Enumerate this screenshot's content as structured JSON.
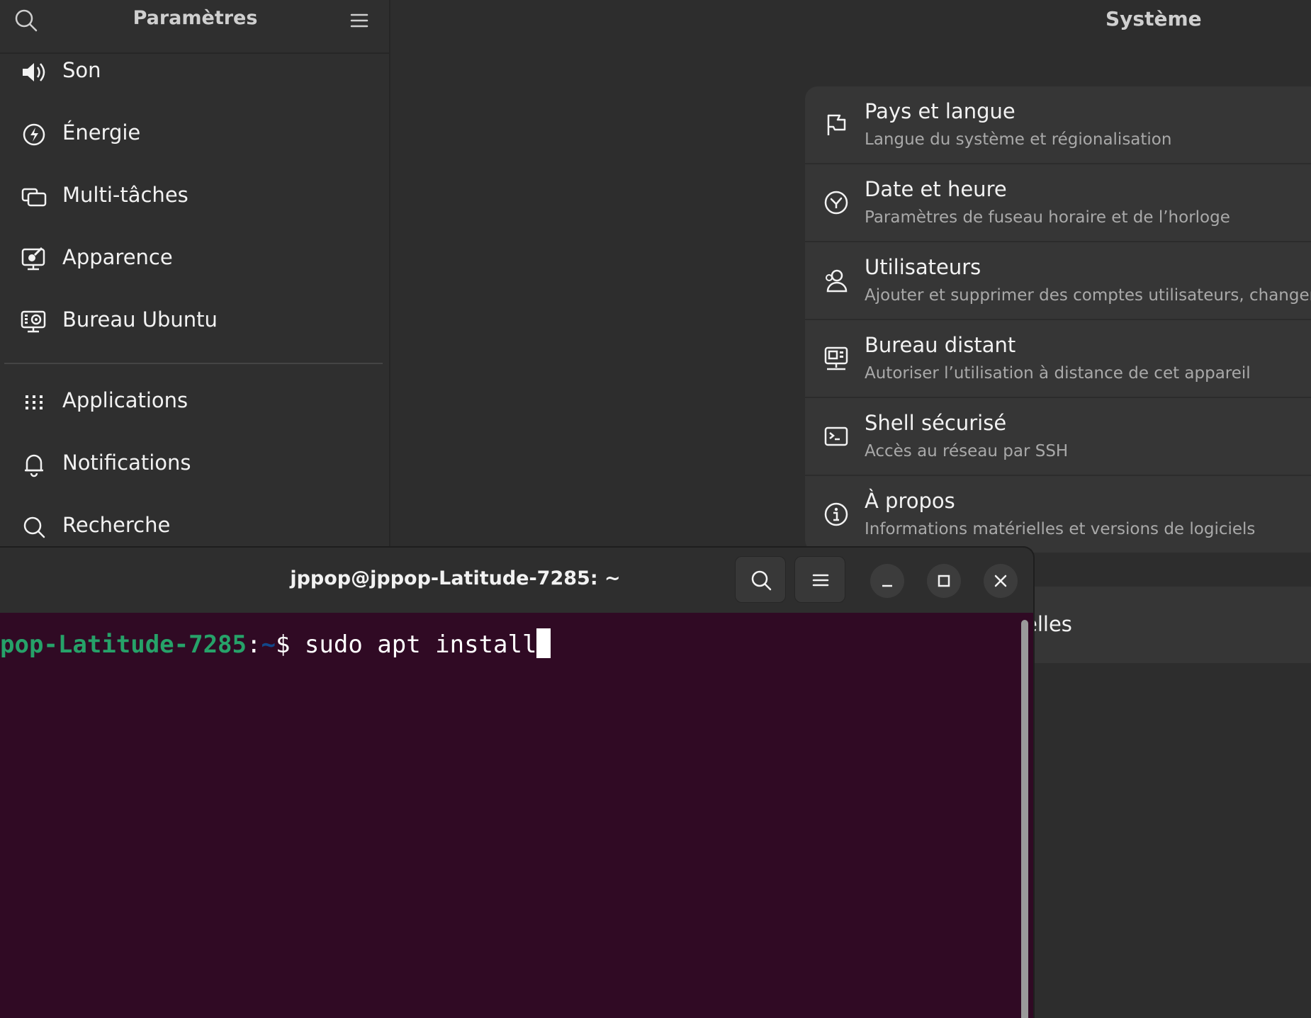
{
  "sidebar": {
    "title": "Paramètres",
    "items": [
      {
        "label": "Son",
        "icon": "speaker-icon"
      },
      {
        "label": "Énergie",
        "icon": "power-icon"
      },
      {
        "label": "Multi-tâches",
        "icon": "multitasking-icon"
      },
      {
        "label": "Apparence",
        "icon": "appearance-icon"
      },
      {
        "label": "Bureau Ubuntu",
        "icon": "ubuntu-desktop-icon"
      },
      {
        "label": "Applications",
        "icon": "apps-grid-icon"
      },
      {
        "label": "Notifications",
        "icon": "bell-icon"
      },
      {
        "label": "Recherche",
        "icon": "search-icon"
      }
    ]
  },
  "main": {
    "title": "Système",
    "rows": [
      {
        "title": "Pays et langue",
        "subtitle": "Langue du système et régionalisation",
        "icon": "flag-icon"
      },
      {
        "title": "Date et heure",
        "subtitle": "Paramètres de fuseau horaire et de l’horloge",
        "icon": "clock-icon"
      },
      {
        "title": "Utilisateurs",
        "subtitle": "Ajouter et supprimer des comptes utilisateurs, changer de",
        "icon": "users-icon"
      },
      {
        "title": "Bureau distant",
        "subtitle": "Autoriser l’utilisation à distance de cet appareil",
        "icon": "remote-desktop-icon"
      },
      {
        "title": "Shell sécurisé",
        "subtitle": "Accès au réseau par SSH",
        "icon": "terminal-icon"
      },
      {
        "title": "À propos",
        "subtitle": "Informations matérielles et versions de logiciels",
        "icon": "info-icon"
      }
    ],
    "partial_row": "elles"
  },
  "terminal": {
    "title": "jppop@jppop-Latitude-7285: ~",
    "prompt_host": "pop-Latitude-7285",
    "prompt_colon": ":",
    "prompt_path": "~",
    "prompt_dollar": "$ ",
    "command": "sudo apt install",
    "colors": {
      "background": "#300a24",
      "host": "#26a269",
      "path": "#12488b"
    }
  }
}
